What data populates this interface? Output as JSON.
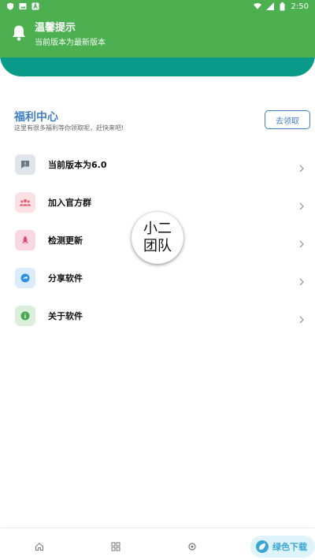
{
  "status_bar": {
    "time": "2:50"
  },
  "notice": {
    "title": "温馨提示",
    "subtitle": "当前版本为最新版本"
  },
  "welfare": {
    "title": "福利中心",
    "subtitle": "这里有很多福利等你领取呢，赶快来吧!",
    "button_label": "去领取"
  },
  "menu": {
    "items": [
      {
        "label": "当前版本为6.0",
        "icon": "message-alert-icon",
        "color": "#dfe5ea"
      },
      {
        "label": "加入官方群",
        "icon": "group-icon",
        "color": "#fde0e4"
      },
      {
        "label": "检测更新",
        "icon": "rocket-icon",
        "color": "#fbd6e3"
      },
      {
        "label": "分享软件",
        "icon": "share-icon",
        "color": "#d8ecfb"
      },
      {
        "label": "关于软件",
        "icon": "info-icon",
        "color": "#dcefdc"
      }
    ]
  },
  "badge": {
    "line1": "小二",
    "line2": "团队"
  },
  "watermark": {
    "text": "绿色下载"
  },
  "colors": {
    "green": "#4caf50",
    "teal": "#0a9a8a",
    "accent": "#3f7fc2"
  }
}
